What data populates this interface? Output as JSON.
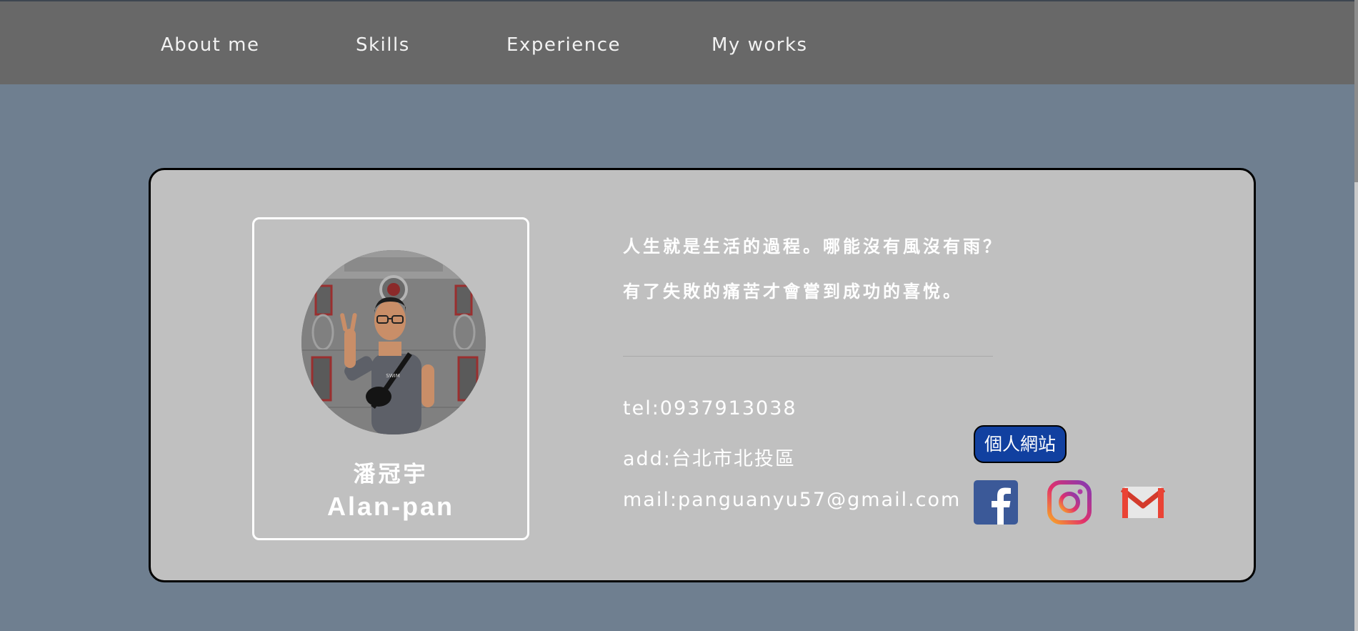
{
  "nav": {
    "items": [
      {
        "label": "About me"
      },
      {
        "label": "Skills"
      },
      {
        "label": "Experience"
      },
      {
        "label": "My works"
      }
    ]
  },
  "profile": {
    "name_zh": "潘冠宇",
    "name_en": "Alan-pan"
  },
  "quotes": [
    "人生就是生活的過程。哪能沒有風沒有雨？",
    "有了失敗的痛苦才會嘗到成功的喜悅。"
  ],
  "contact": {
    "tel": "tel:0937913038",
    "add": "add:台北市北投區",
    "mail": "mail:panguanyu57@gmail.com"
  },
  "site_button": {
    "label": "個人網站"
  },
  "social": [
    {
      "icon": "facebook-icon",
      "color": "#3b5998"
    },
    {
      "icon": "instagram-icon",
      "color": "#c13584"
    },
    {
      "icon": "gmail-icon",
      "color": "#ea4335"
    }
  ],
  "colors": {
    "page_background": "#6f7f90",
    "nav_background": "#686868",
    "card_background": "#c0c0c0",
    "button_background": "#1140a0"
  }
}
